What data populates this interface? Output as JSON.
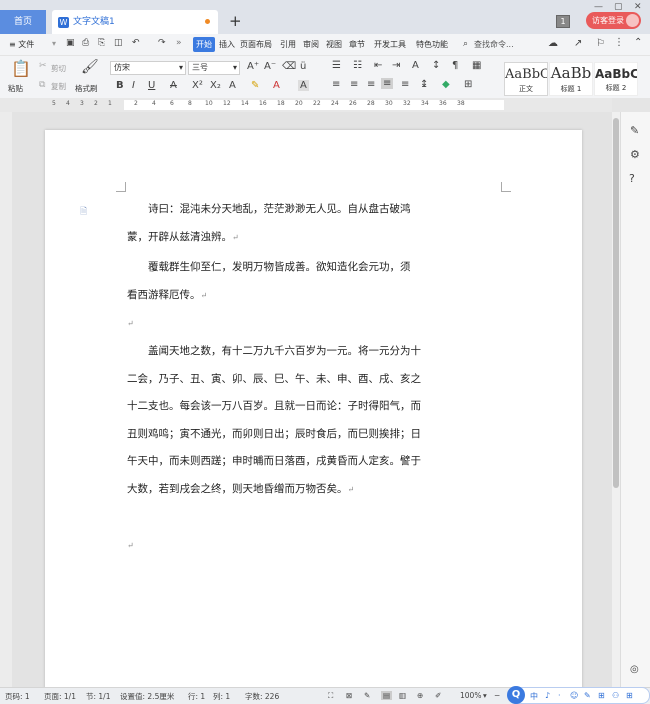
{
  "tabs": {
    "home": "首页",
    "doc": "文字文稿1",
    "new": "+"
  },
  "titlebar": {
    "badge": "1",
    "login": "访客登录",
    "min": "—",
    "max": "▢",
    "close": "✕"
  },
  "menu": {
    "file": "≡ 文件",
    "items": [
      "插入",
      "页面布局",
      "引用",
      "审阅",
      "视图",
      "章节",
      "开发工具",
      "特色功能"
    ],
    "start": "开始",
    "search": "查找命令..."
  },
  "toolbar": {
    "paste": "粘贴",
    "cut": "剪切",
    "copy": "复制",
    "format_painter": "格式刷",
    "font": "仿宋",
    "size": "三号"
  },
  "styles": [
    {
      "sample": "AaBbCcDd",
      "name": "正文"
    },
    {
      "sample": "AaBb",
      "name": "标题 1"
    },
    {
      "sample": "AaBbC",
      "name": "标题 2"
    }
  ],
  "ruler": {
    "left": [
      "5",
      "4",
      "3",
      "2",
      "1"
    ],
    "right": [
      "2",
      "4",
      "6",
      "8",
      "10",
      "12",
      "14",
      "16",
      "18",
      "20",
      "22",
      "24",
      "26",
      "28",
      "30",
      "32",
      "34",
      "36",
      "38"
    ]
  },
  "doc": {
    "paragraphs": [
      "诗曰：混沌未分天地乱，茫茫渺渺无人见。自从盘古破鸿蒙，开辟从兹清浊辨。",
      "覆载群生仰至仁，发明万物皆成善。欲知造化会元功，须看西游释厄传。",
      "",
      "盖闻天地之数，有十二万九千六百岁为一元。将一元分为十二会，乃子、丑、寅、卯、辰、巳、午、未、申、酉、戌、亥之十二支也。每会该一万八百岁。且就一日而论：子时得阳气，而丑则鸡鸣；寅不通光，而卯则日出；辰时食后，而巳则挨排；日午天中，而未则西蹉；申时晡而日落酉，戌黄昏而人定亥。譬于大数，若到戌会之终，则天地昏缯而万物否矣。",
      ""
    ],
    "ret": "↵"
  },
  "status": {
    "page_num": "页码: 1",
    "pages": "页面: 1/1",
    "section": "节: 1/1",
    "setting": "设置值: 2.5厘米",
    "row": "行: 1",
    "col": "列: 1",
    "words": "字数: 226",
    "zoom": "100%"
  },
  "ime": {
    "q": "Q",
    "items": [
      "中",
      "♪",
      "·",
      "☺",
      "✎",
      "⊞",
      "⚇",
      "⊞"
    ]
  }
}
